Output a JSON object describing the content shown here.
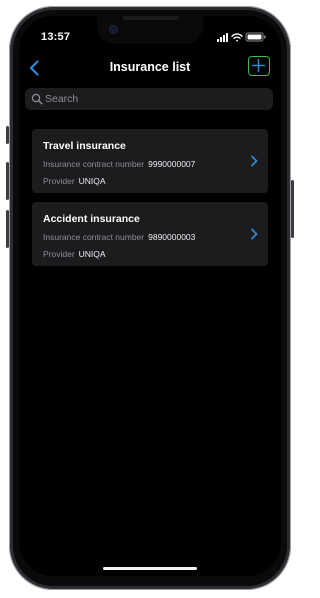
{
  "status": {
    "time": "13:57"
  },
  "nav": {
    "title": "Insurance list"
  },
  "search": {
    "placeholder": "Search"
  },
  "insurances": [
    {
      "title": "Travel insurance",
      "contract_label": "Insurance contract number",
      "contract_number": "9990000007",
      "provider_label": "Provider",
      "provider": "UNIQA"
    },
    {
      "title": "Accident insurance",
      "contract_label": "Insurance contract number",
      "contract_number": "9890000003",
      "provider_label": "Provider",
      "provider": "UNIQA"
    }
  ],
  "colors": {
    "accent_blue": "#2f86d8",
    "add_button_green": "#3fb950",
    "card_bg": "#1c1c1f",
    "screen_bg": "#000000"
  },
  "icons": {
    "back": "chevron-left-icon",
    "add": "plus-icon",
    "search": "magnifier-icon",
    "row": "chevron-right-icon",
    "wifi": "wifi-icon",
    "signal": "cellular-signal-icon",
    "battery": "battery-icon"
  }
}
